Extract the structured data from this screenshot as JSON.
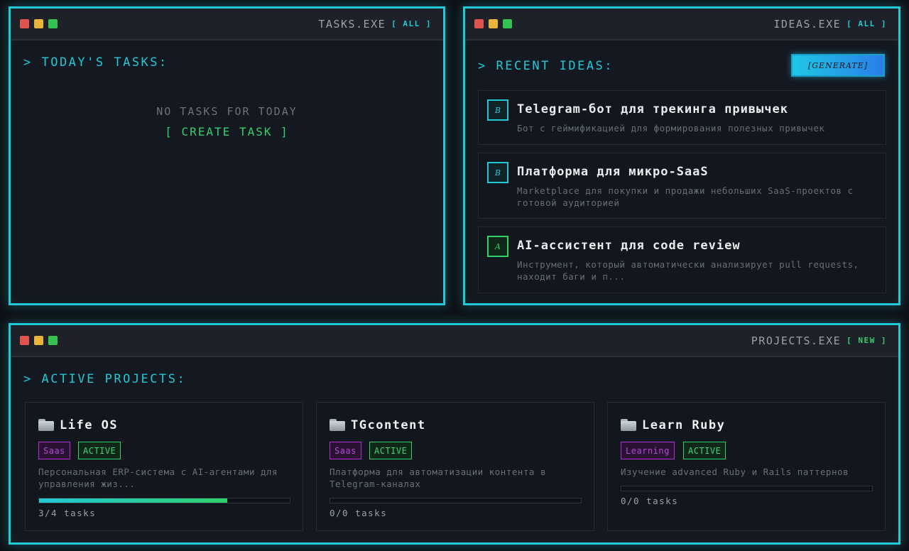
{
  "tasks_window": {
    "title": "TASKS.EXE",
    "link": "[ ALL ]",
    "heading": "> TODAY'S TASKS:",
    "empty_text": "NO TASKS FOR TODAY",
    "create_label": "[ CREATE TASK ]"
  },
  "ideas_window": {
    "title": "IDEAS.EXE",
    "link": "[ ALL ]",
    "heading": "> RECENT IDEAS:",
    "generate_label": "[GENERATE]",
    "ideas": [
      {
        "badge": "B",
        "title": "Telegram-бот для трекинга привычек",
        "desc": "Бот с геймификацией для формирования полезных привычек"
      },
      {
        "badge": "B",
        "title": "Платформа для микро-SaaS",
        "desc": "Marketplace для покупки и продажи небольших SaaS-проектов с готовой аудиторией"
      },
      {
        "badge": "A",
        "title": "AI-ассистент для code review",
        "desc": "Инструмент, который автоматически анализирует pull requests, находит баги и п..."
      }
    ]
  },
  "projects_window": {
    "title": "PROJECTS.EXE",
    "link": "[ NEW ]",
    "heading": "> ACTIVE PROJECTS:",
    "projects": [
      {
        "name": "Life OS",
        "category": "Saas",
        "status": "ACTIVE",
        "desc": "Персональная ERP-система с AI-агентами для управления жиз...",
        "progress": 0.75,
        "tasks": "3/4 tasks"
      },
      {
        "name": "TGcontent",
        "category": "Saas",
        "status": "ACTIVE",
        "desc": "Платформа для автоматизации контента в Telegram-каналах",
        "progress": 0,
        "tasks": "0/0 tasks"
      },
      {
        "name": "Learn Ruby",
        "category": "Learning",
        "status": "ACTIVE",
        "desc": "Изучение advanced Ruby и Rails паттернов",
        "progress": 0,
        "tasks": "0/0 tasks"
      }
    ]
  },
  "colors": {
    "accent_cyan": "#22c8d6",
    "accent_green": "#2fd16b",
    "accent_purple": "#b02fd6",
    "background": "#0e1217"
  }
}
